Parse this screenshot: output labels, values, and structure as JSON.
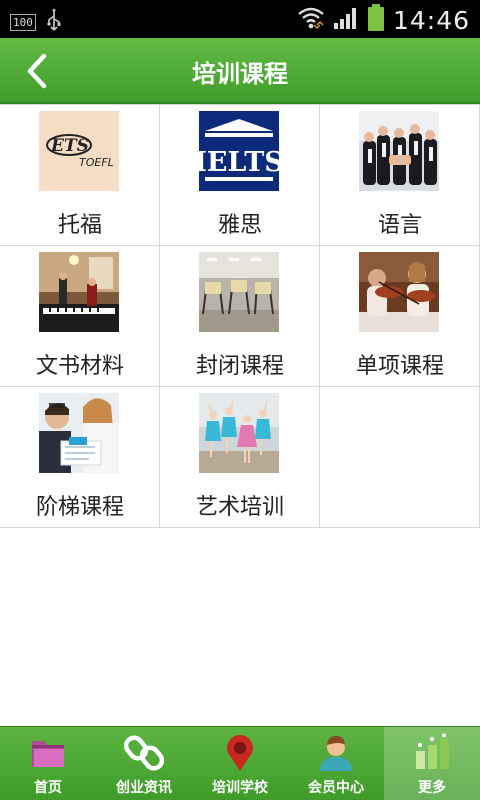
{
  "status_bar": {
    "battery_badge": "100",
    "time": "14:46"
  },
  "header": {
    "title": "培训课程",
    "back_icon": "chevron-left-icon"
  },
  "courses": [
    {
      "label": "托福",
      "thumb_text": "ETS",
      "thumb_subtext": "TOEFL"
    },
    {
      "label": "雅思",
      "thumb_text": "IELTS"
    },
    {
      "label": "语言"
    },
    {
      "label": "文书材料"
    },
    {
      "label": "封闭课程"
    },
    {
      "label": "单项课程"
    },
    {
      "label": "阶梯课程"
    },
    {
      "label": "艺术培训"
    }
  ],
  "bottom_nav": {
    "items": [
      {
        "label": "首页",
        "icon": "folder-icon"
      },
      {
        "label": "创业资讯",
        "icon": "link-icon"
      },
      {
        "label": "培训学校",
        "icon": "map-pin-icon"
      },
      {
        "label": "会员中心",
        "icon": "user-icon"
      },
      {
        "label": "更多",
        "icon": "more-icon"
      }
    ],
    "active_index": 4
  },
  "colors": {
    "header_green": "#4caf35",
    "nav_green": "#4ea836"
  }
}
